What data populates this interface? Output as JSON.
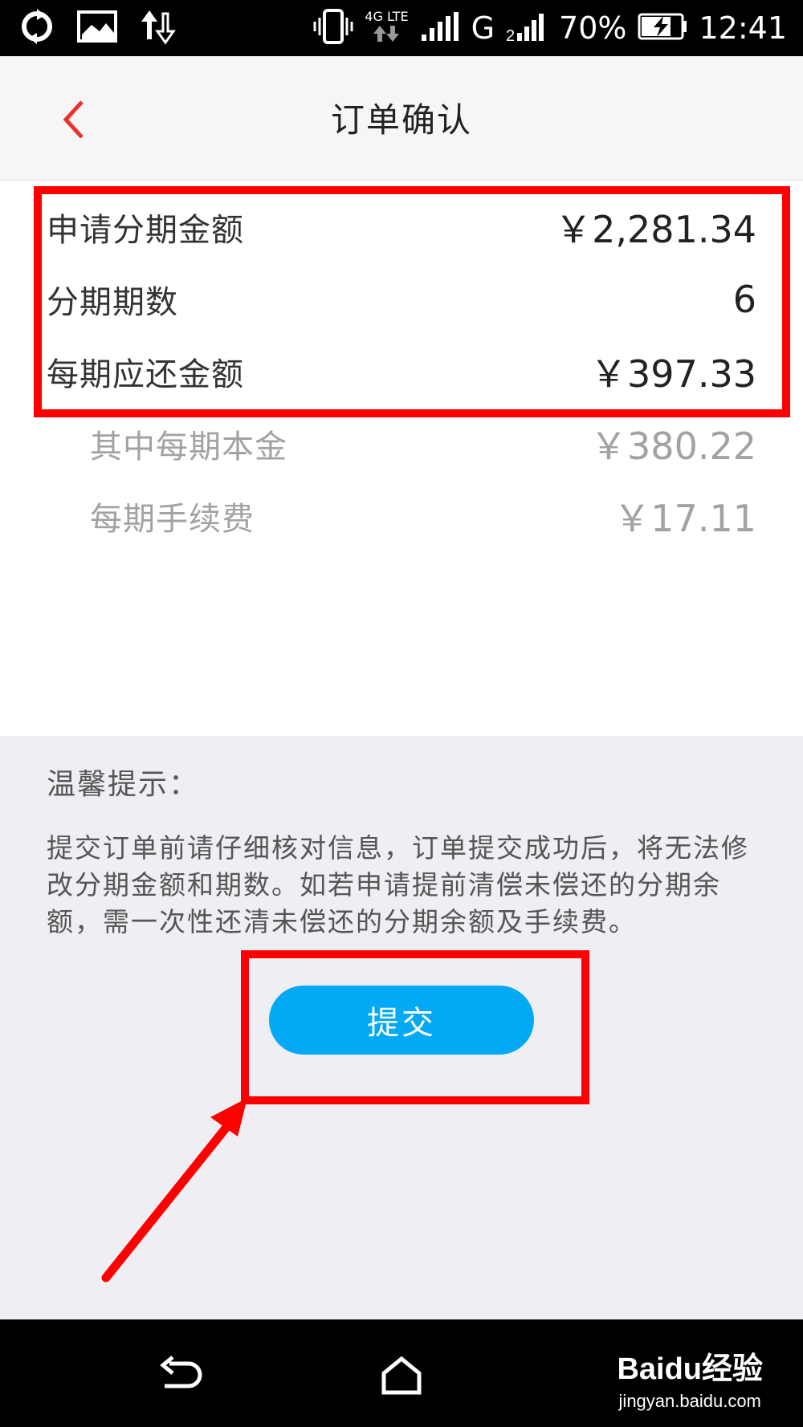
{
  "status_bar": {
    "network_label": "4G LTE",
    "carrier_g": "G",
    "battery": "70%",
    "time": "12:41"
  },
  "header": {
    "title": "订单确认"
  },
  "summary": {
    "amount_label": "申请分期金额",
    "amount_value": "￥2,281.34",
    "periods_label": "分期期数",
    "periods_value": "6",
    "per_period_label": "每期应还金额",
    "per_period_value": "￥397.33",
    "principal_label": "其中每期本金",
    "principal_value": "￥380.22",
    "fee_label": "每期手续费",
    "fee_value": "￥17.11"
  },
  "tips": {
    "title": "温馨提示：",
    "body": "提交订单前请仔细核对信息，订单提交成功后，将无法修改分期金额和期数。如若申请提前清偿未偿还的分期余额，需一次性还清未偿还的分期余额及手续费。"
  },
  "actions": {
    "submit_label": "提交"
  },
  "watermark": {
    "logo": "Baidu经验",
    "url": "jingyan.baidu.com"
  },
  "colors": {
    "accent": "#03a9f4",
    "annotation": "#ff0000",
    "back_arrow": "#e8322a"
  }
}
